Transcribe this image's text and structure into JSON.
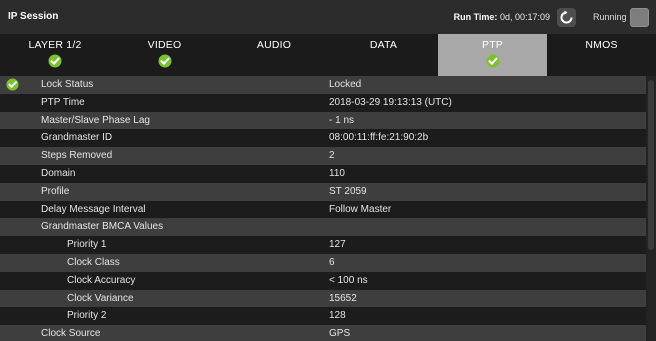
{
  "window": {
    "title": "IP Session",
    "run_time_label": "Run Time:",
    "run_time_value": "0d, 00:17:09",
    "status": "Running"
  },
  "tabs": [
    {
      "label": "LAYER 1/2",
      "check": true,
      "active": false
    },
    {
      "label": "VIDEO",
      "check": true,
      "active": false
    },
    {
      "label": "AUDIO",
      "check": false,
      "active": false
    },
    {
      "label": "DATA",
      "check": false,
      "active": false
    },
    {
      "label": "PTP",
      "check": true,
      "active": true
    },
    {
      "label": "NMOS",
      "check": false,
      "active": false
    }
  ],
  "rows": [
    {
      "name": "Lock Status",
      "value": "Locked",
      "ok": true,
      "indent": false
    },
    {
      "name": "PTP Time",
      "value": "2018-03-29 19:13:13 (UTC)",
      "ok": false,
      "indent": false
    },
    {
      "name": "Master/Slave Phase Lag",
      "value": "- 1 ns",
      "ok": false,
      "indent": false
    },
    {
      "name": "Grandmaster ID",
      "value": "08:00:11:ff:fe:21:90:2b",
      "ok": false,
      "indent": false
    },
    {
      "name": "Steps Removed",
      "value": "2",
      "ok": false,
      "indent": false
    },
    {
      "name": "Domain",
      "value": "110",
      "ok": false,
      "indent": false
    },
    {
      "name": "Profile",
      "value": "ST 2059",
      "ok": false,
      "indent": false
    },
    {
      "name": "Delay Message Interval",
      "value": "Follow Master",
      "ok": false,
      "indent": false
    },
    {
      "name": "Grandmaster BMCA Values",
      "value": "",
      "ok": false,
      "indent": false
    },
    {
      "name": "Priority 1",
      "value": "127",
      "ok": false,
      "indent": true
    },
    {
      "name": "Clock Class",
      "value": "6",
      "ok": false,
      "indent": true
    },
    {
      "name": "Clock Accuracy",
      "value": "< 100 ns",
      "ok": false,
      "indent": true
    },
    {
      "name": "Clock Variance",
      "value": "15652",
      "ok": false,
      "indent": true
    },
    {
      "name": "Priority 2",
      "value": "128",
      "ok": false,
      "indent": true
    },
    {
      "name": "Clock Source",
      "value": "GPS",
      "ok": false,
      "indent": false
    }
  ],
  "colors": {
    "check_green": "#7cc22f",
    "active_tab": "#a8a8a8"
  }
}
